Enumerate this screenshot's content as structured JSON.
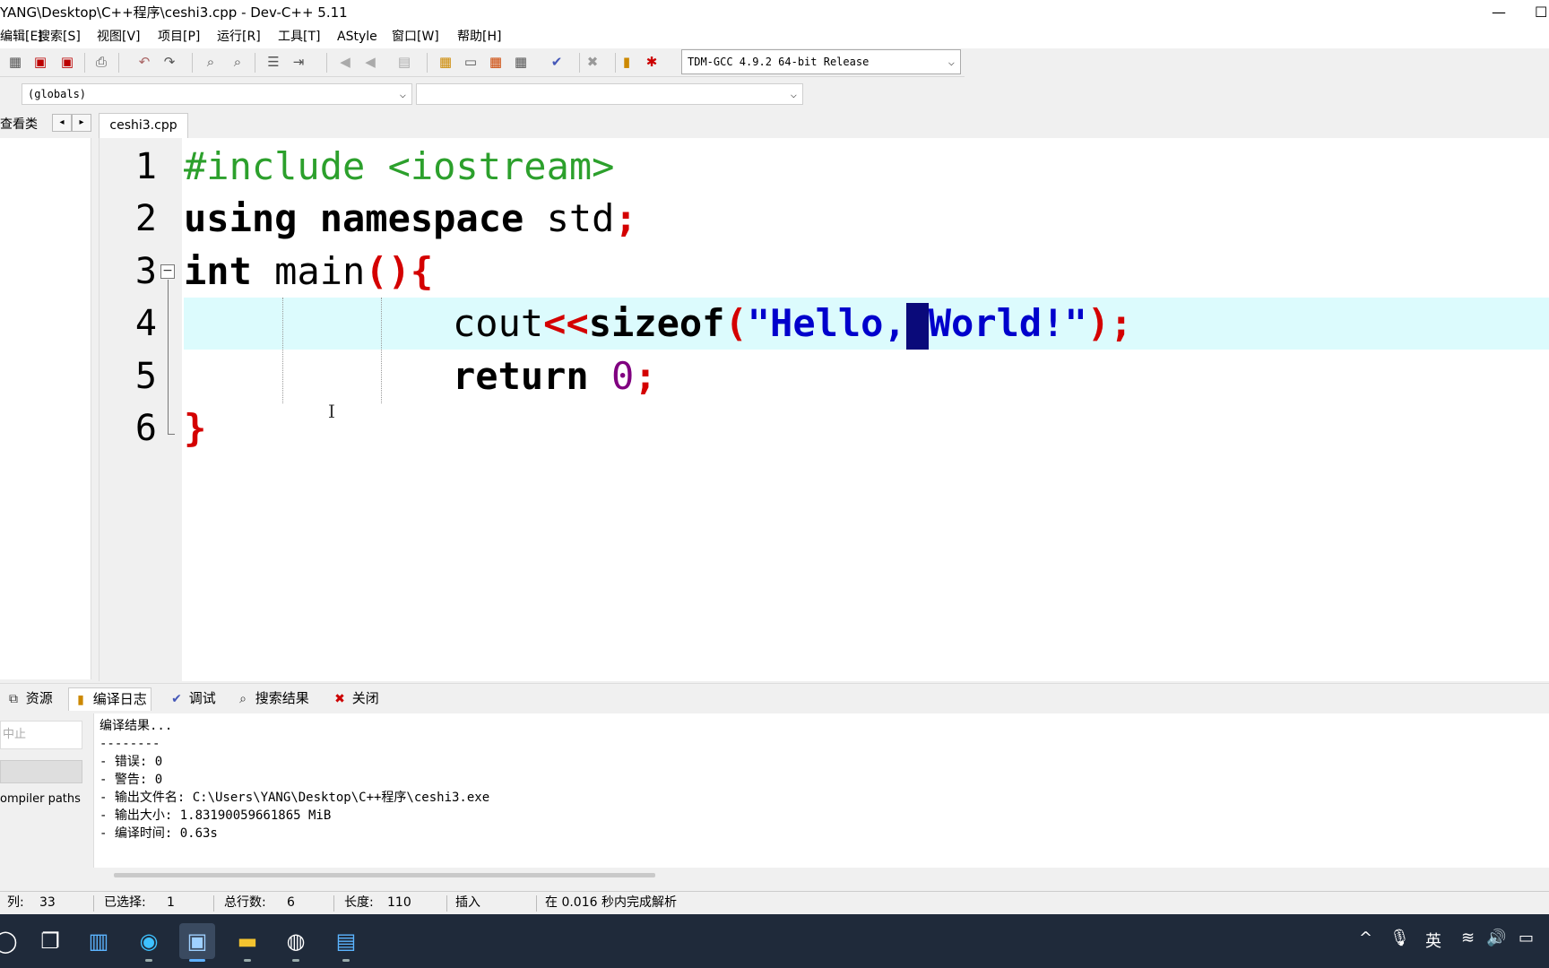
{
  "window": {
    "title": "YANG\\Desktop\\C++程序\\ceshi3.cpp - Dev-C++ 5.11",
    "minimize_glyph": "—",
    "maximize_glyph": "☐"
  },
  "menu": [
    {
      "label": "编辑[E]"
    },
    {
      "label": "搜索[S]"
    },
    {
      "label": "视图[V]"
    },
    {
      "label": "项目[P]"
    },
    {
      "label": "运行[R]"
    },
    {
      "label": "工具[T]"
    },
    {
      "label": "AStyle"
    },
    {
      "label": "窗口[W]"
    },
    {
      "label": "帮助[H]"
    }
  ],
  "toolbar": {
    "compiler": "TDM-GCC 4.9.2 64-bit Release"
  },
  "scope": {
    "globals": "(globals)",
    "members": ""
  },
  "left_panel": {
    "tab_label": "查看类",
    "prev": "◂",
    "next": "▸"
  },
  "editor": {
    "file_tab": "ceshi3.cpp",
    "line_numbers": [
      "1",
      "2",
      "3",
      "4",
      "5",
      "6"
    ],
    "fold_glyph": "−",
    "code": {
      "l1": "#include <iostream>",
      "l2_kw1": "using",
      "l2_kw2": "namespace",
      "l2_id": "std",
      "l2_sym": ";",
      "l3_kw": "int",
      "l3_id": "main",
      "l3_sym": "(){",
      "l4_id": "cout",
      "l4_op": "<<",
      "l4_kw": "sizeof",
      "l4_open": "(",
      "l4_str1": "\"Hello,",
      "l4_caret": " ",
      "l4_str2": "World!\"",
      "l4_close": ");",
      "l5_kw": "return",
      "l5_num": "0",
      "l5_sym": ";",
      "l6_sym": "}"
    }
  },
  "bottom_tabs": [
    {
      "label": "资源",
      "icon": "resources-icon",
      "glyph": "⧉"
    },
    {
      "label": "编译日志",
      "icon": "compile-log-icon",
      "glyph": "▮"
    },
    {
      "label": "调试",
      "icon": "debug-check-icon",
      "glyph": "✔"
    },
    {
      "label": "搜索结果",
      "icon": "search-results-icon",
      "glyph": "⌕"
    },
    {
      "label": "关闭",
      "icon": "close-icon",
      "glyph": "✖"
    }
  ],
  "bottom_left": {
    "stop_label": "中止",
    "compiler_paths": "ompiler paths"
  },
  "compile_log": [
    "编译结果...",
    "--------",
    "- 错误: 0",
    "- 警告: 0",
    "- 输出文件名: C:\\Users\\YANG\\Desktop\\C++程序\\ceshi3.exe",
    "- 输出大小: 1.83190059661865 MiB",
    "- 编译时间: 0.63s"
  ],
  "status": {
    "col_label": "列:",
    "col_value": "33",
    "sel_label": "已选择:",
    "sel_value": "1",
    "lines_label": "总行数:",
    "lines_value": "6",
    "len_label": "长度:",
    "len_value": "110",
    "mode": "插入",
    "parse": "在 0.016 秒内完成解析"
  },
  "taskbar": {
    "tray_ime": "英",
    "tray_up": "^",
    "tray_mic": "🎙",
    "tray_wifi": "≋",
    "tray_vol": "🔊",
    "tray_battery": "▭"
  }
}
